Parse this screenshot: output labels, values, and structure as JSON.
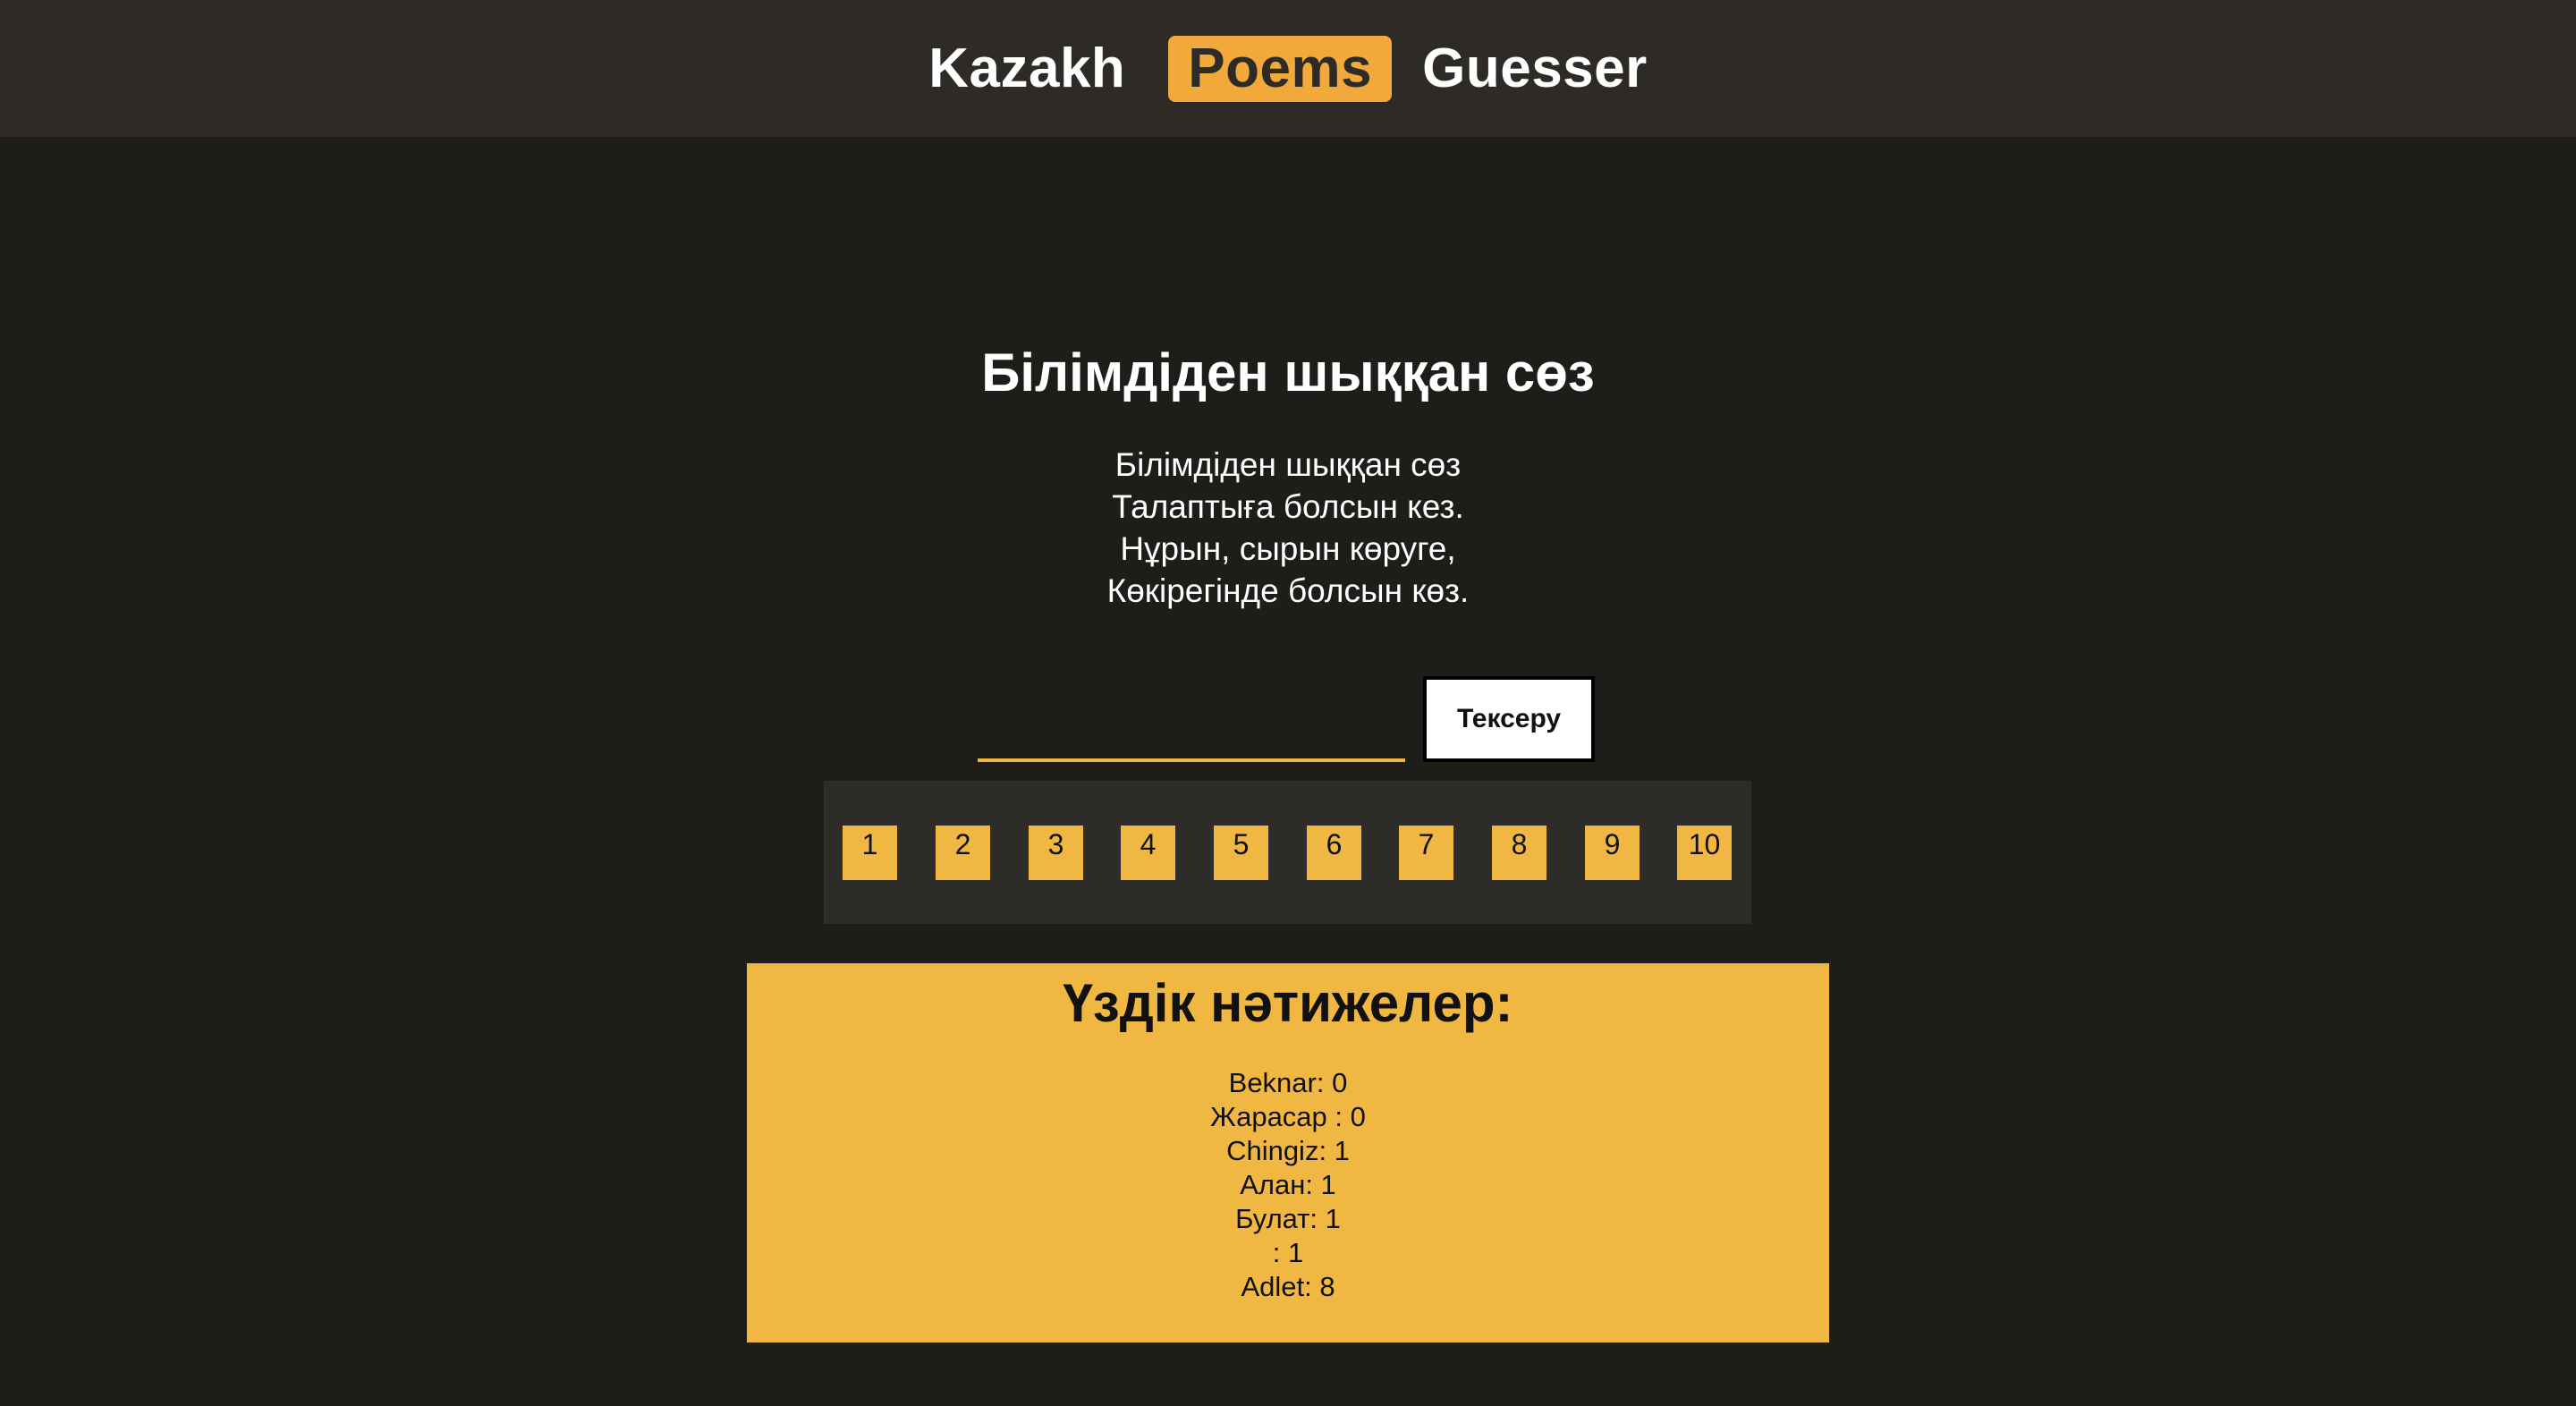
{
  "header": {
    "brand_left": "Kazakh",
    "brand_accent": "Poems",
    "brand_right": "Guesser",
    "accent_color": "#f0a93a",
    "background_color": "#2e2b27"
  },
  "poem": {
    "title": "Білімдіден шыққан сөз",
    "lines": [
      "Білімдіден шыққан сөз",
      "Талаптыға болсын кез.",
      "Нұрын, сырын көруге,",
      "Көкірегінде болсын көз."
    ]
  },
  "guess": {
    "input_value": "",
    "check_label": "Тексеру"
  },
  "attempts": {
    "labels": [
      "1",
      "2",
      "3",
      "4",
      "5",
      "6",
      "7",
      "8",
      "9",
      "10"
    ],
    "box_color": "#f0b842"
  },
  "leaderboard": {
    "title": "Үздік нәтижелер:",
    "entries": [
      "Beknar: 0",
      "Жарасар : 0",
      "Chingiz: 1",
      "Алан: 1",
      "Булат: 1",
      ": 1",
      "Adlet: 8"
    ],
    "background_color": "#f0b842"
  }
}
